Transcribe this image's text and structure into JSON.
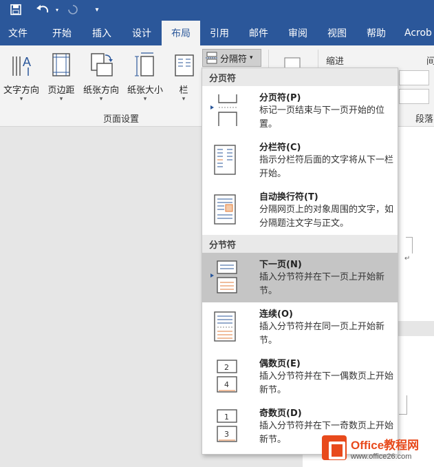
{
  "qat": {
    "save_icon": "save-icon",
    "undo_icon": "undo-icon",
    "redo_icon": "redo-icon",
    "customize_icon": "customize-qat-icon"
  },
  "tabs": [
    {
      "label": "文件",
      "active": false
    },
    {
      "label": "开始",
      "active": false
    },
    {
      "label": "插入",
      "active": false
    },
    {
      "label": "设计",
      "active": false
    },
    {
      "label": "布局",
      "active": true
    },
    {
      "label": "引用",
      "active": false
    },
    {
      "label": "邮件",
      "active": false
    },
    {
      "label": "审阅",
      "active": false
    },
    {
      "label": "视图",
      "active": false
    },
    {
      "label": "帮助",
      "active": false
    },
    {
      "label": "Acrob",
      "active": false
    }
  ],
  "ribbon": {
    "page_setup": {
      "buttons": [
        {
          "label": "文字方向",
          "icon": "text-direction-icon"
        },
        {
          "label": "页边距",
          "icon": "margins-icon"
        },
        {
          "label": "纸张方向",
          "icon": "orientation-icon"
        },
        {
          "label": "纸张大小",
          "icon": "size-icon"
        },
        {
          "label": "栏",
          "icon": "columns-icon"
        }
      ],
      "group_label": "页面设置"
    },
    "breaks_button": "分隔符",
    "indent_label": "缩进",
    "paragraph_label": "段落",
    "spacing_label_partial": "间"
  },
  "breaks_menu": {
    "page_breaks_header": "分页符",
    "section_breaks_header": "分节符",
    "page_items": [
      {
        "title": "分页符(P)",
        "desc": "标记一页结束与下一页开始的位置。",
        "highlighted": false
      },
      {
        "title": "分栏符(C)",
        "desc": "指示分栏符后面的文字将从下一栏开始。",
        "highlighted": false
      },
      {
        "title": "自动换行符(T)",
        "desc": "分隔网页上的对象周围的文字，如分隔题注文字与正文。",
        "highlighted": false
      }
    ],
    "section_items": [
      {
        "title": "下一页(N)",
        "desc": "插入分节符并在下一页上开始新节。",
        "highlighted": true
      },
      {
        "title": "连续(O)",
        "desc": "插入分节符并在同一页上开始新节。",
        "highlighted": false
      },
      {
        "title": "偶数页(E)",
        "desc": "插入分节符并在下一偶数页上开始新节。",
        "highlighted": false
      },
      {
        "title": "奇数页(D)",
        "desc": "插入分节符并在下一奇数页上开始新节。",
        "highlighted": false
      }
    ]
  },
  "watermark": {
    "brand": "Office教程网",
    "url": "www.office26.com"
  },
  "colors": {
    "title_bar": "#2b579a",
    "accent_orange": "#e84a1c"
  }
}
